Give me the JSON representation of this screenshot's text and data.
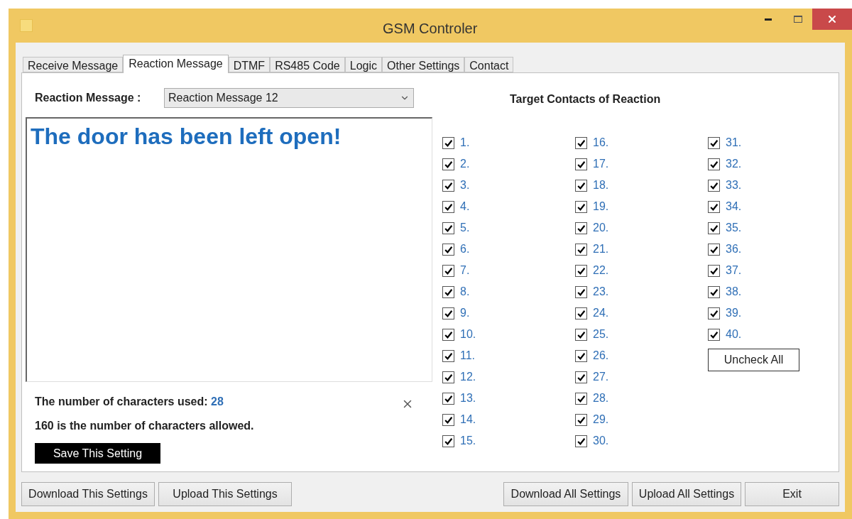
{
  "window": {
    "title": "GSM Controler"
  },
  "tabs": [
    {
      "label": "Receive Message",
      "selected": false
    },
    {
      "label": "Reaction Message",
      "selected": true
    },
    {
      "label": "DTMF",
      "selected": false
    },
    {
      "label": "RS485 Code",
      "selected": false
    },
    {
      "label": "Logic",
      "selected": false
    },
    {
      "label": "Other Settings",
      "selected": false
    },
    {
      "label": "Contact",
      "selected": false
    }
  ],
  "reaction_message": {
    "label": "Reaction Message :",
    "value": "Reaction Message 12"
  },
  "message_text": "The door has been left open!",
  "characters_used": {
    "label": "The number of characters used:",
    "value": "28"
  },
  "characters_allowed": "160 is the number of characters allowed.",
  "save_button": "Save This Setting",
  "contacts": {
    "title": "Target Contacts of Reaction",
    "items": [
      {
        "label": "1.",
        "checked": true
      },
      {
        "label": "2.",
        "checked": true
      },
      {
        "label": "3.",
        "checked": true
      },
      {
        "label": "4.",
        "checked": true
      },
      {
        "label": "5.",
        "checked": true
      },
      {
        "label": "6.",
        "checked": true
      },
      {
        "label": "7.",
        "checked": true
      },
      {
        "label": "8.",
        "checked": true
      },
      {
        "label": "9.",
        "checked": true
      },
      {
        "label": "10.",
        "checked": true
      },
      {
        "label": "11.",
        "checked": true
      },
      {
        "label": "12.",
        "checked": true
      },
      {
        "label": "13.",
        "checked": true
      },
      {
        "label": "14.",
        "checked": true
      },
      {
        "label": "15.",
        "checked": true
      },
      {
        "label": "16.",
        "checked": true
      },
      {
        "label": "17.",
        "checked": true
      },
      {
        "label": "18.",
        "checked": true
      },
      {
        "label": "19.",
        "checked": true
      },
      {
        "label": "20.",
        "checked": true
      },
      {
        "label": "21.",
        "checked": true
      },
      {
        "label": "22.",
        "checked": true
      },
      {
        "label": "23.",
        "checked": true
      },
      {
        "label": "24.",
        "checked": true
      },
      {
        "label": "25.",
        "checked": true
      },
      {
        "label": "26.",
        "checked": true
      },
      {
        "label": "27.",
        "checked": true
      },
      {
        "label": "28.",
        "checked": true
      },
      {
        "label": "29.",
        "checked": true
      },
      {
        "label": "30.",
        "checked": true
      },
      {
        "label": "31.",
        "checked": true
      },
      {
        "label": "32.",
        "checked": true
      },
      {
        "label": "33.",
        "checked": true
      },
      {
        "label": "34.",
        "checked": true
      },
      {
        "label": "35.",
        "checked": true
      },
      {
        "label": "36.",
        "checked": true
      },
      {
        "label": "37.",
        "checked": true
      },
      {
        "label": "38.",
        "checked": true
      },
      {
        "label": "39.",
        "checked": true
      },
      {
        "label": "40.",
        "checked": true
      }
    ],
    "uncheck_all": "Uncheck All"
  },
  "bottom_buttons_left": [
    "Download This Settings",
    "Upload This Settings"
  ],
  "bottom_buttons_right": [
    "Download All Settings",
    "Upload All Settings",
    "Exit"
  ]
}
